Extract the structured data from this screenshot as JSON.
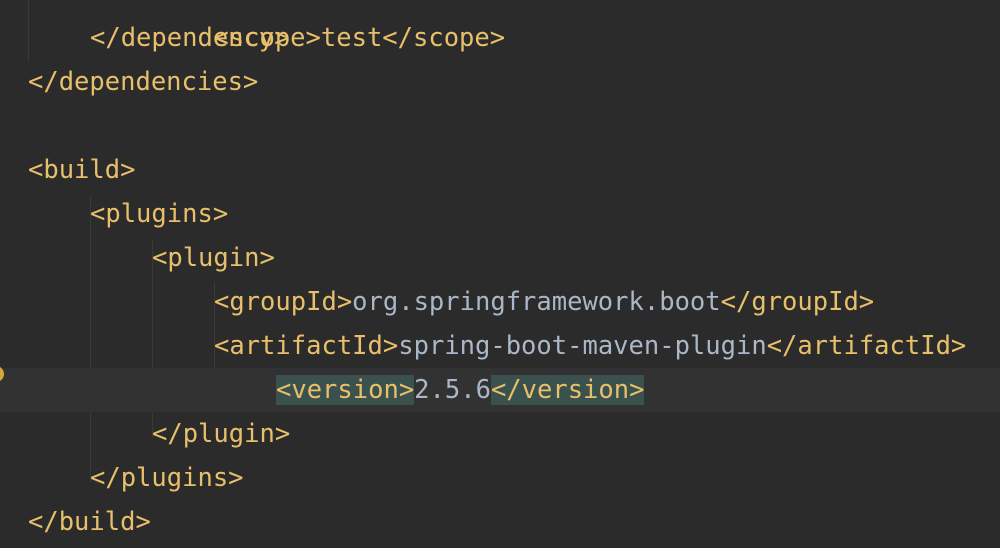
{
  "editor": {
    "clipped_top": "<scope>test</scope>",
    "lines": [
      {
        "indent": 1,
        "open": "</dependency>"
      },
      {
        "indent": 0,
        "open": "</dependencies>"
      },
      {
        "indent": 0,
        "open": ""
      },
      {
        "indent": 0,
        "open": "<build>"
      },
      {
        "indent": 1,
        "open": "<plugins>"
      },
      {
        "indent": 2,
        "open": "<plugin>"
      },
      {
        "indent": 3,
        "open": "<groupId>",
        "text": "org.springframework.boot",
        "close": "</groupId>"
      },
      {
        "indent": 3,
        "open": "<artifactId>",
        "text": "spring-boot-maven-plugin",
        "close": "</artifactId>"
      },
      {
        "indent": 4,
        "open": "<version>",
        "text": "2.5.6",
        "close": "</version>",
        "current": true,
        "matched": true
      },
      {
        "indent": 2,
        "open": "</plugin>"
      },
      {
        "indent": 1,
        "open": "</plugins>"
      },
      {
        "indent": 0,
        "open": "</build>"
      }
    ],
    "colors": {
      "background": "#2b2b2b",
      "tag": "#e8bf6a",
      "text": "#a9b7c6",
      "current_line": "#323232",
      "tag_match_highlight": "#3b514d",
      "gutter_marker": "#d8a53a"
    },
    "gutter_icon": "bulb-icon"
  }
}
